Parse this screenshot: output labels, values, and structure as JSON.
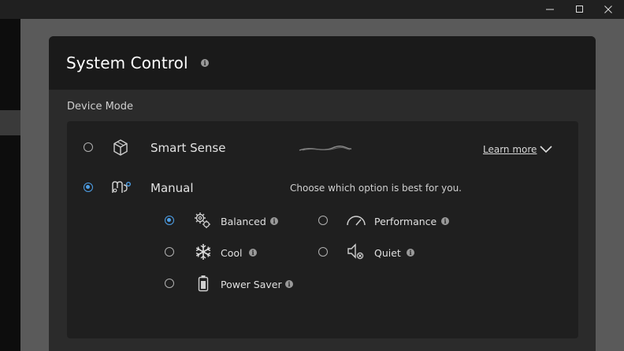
{
  "window": {
    "controls": [
      "minimize-icon",
      "maximize-icon",
      "close-icon"
    ]
  },
  "header": {
    "title": "System Control",
    "info_icon": "info-icon"
  },
  "device_mode": {
    "label": "Device Mode",
    "smart_sense": {
      "label": "Smart Sense",
      "selected": false,
      "icon": "cube-icon",
      "learn_more": "Learn more"
    },
    "manual": {
      "label": "Manual",
      "selected": true,
      "icon": "manual-icon",
      "hint": "Choose which option is best for you.",
      "options": [
        {
          "label": "Balanced",
          "selected": true,
          "icon": "gears-icon"
        },
        {
          "label": "Performance",
          "selected": false,
          "icon": "speedometer-icon"
        },
        {
          "label": "Cool",
          "selected": false,
          "icon": "snowflake-icon"
        },
        {
          "label": "Quiet",
          "selected": false,
          "icon": "speaker-icon"
        },
        {
          "label": "Power Saver",
          "selected": false,
          "icon": "battery-icon"
        }
      ]
    }
  },
  "colors": {
    "accent": "#4ea0e8",
    "card_background": "#2b2b2b",
    "header_background": "#1a1a1a"
  }
}
